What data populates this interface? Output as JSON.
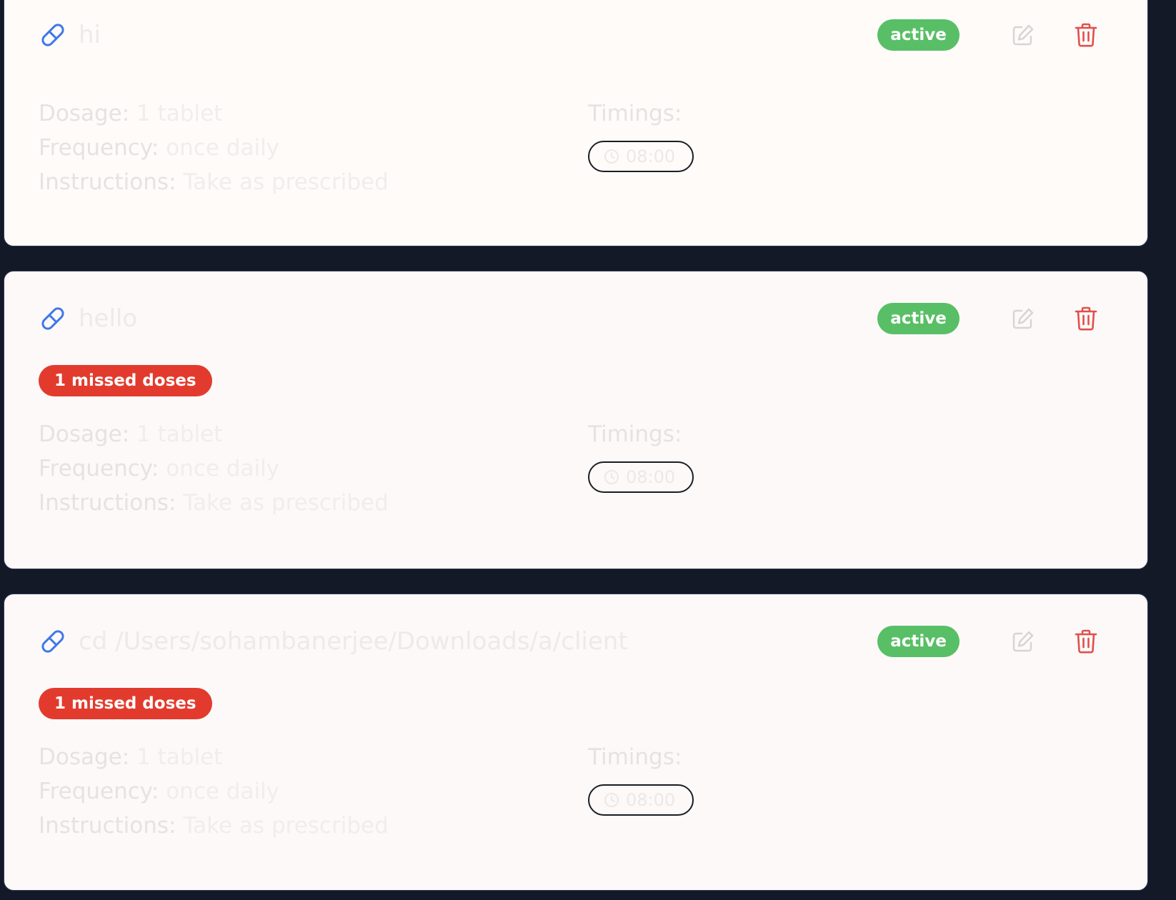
{
  "medications": [
    {
      "name": "hi",
      "status": "active",
      "missed": "",
      "dosage_label": "Dosage:",
      "dosage": "1 tablet",
      "frequency_label": "Frequency:",
      "frequency": "once daily",
      "instructions_label": "Instructions:",
      "instructions": "Take as prescribed",
      "timings_label": "Timings:",
      "time": "08:00"
    },
    {
      "name": "hello",
      "status": "active",
      "missed": "1 missed doses",
      "dosage_label": "Dosage:",
      "dosage": "1 tablet",
      "frequency_label": "Frequency:",
      "frequency": "once daily",
      "instructions_label": "Instructions:",
      "instructions": "Take as prescribed",
      "timings_label": "Timings:",
      "time": "08:00"
    },
    {
      "name": "cd /Users/sohambanerjee/Downloads/a/client",
      "status": "active",
      "missed": "1 missed doses",
      "dosage_label": "Dosage:",
      "dosage": "1 tablet",
      "frequency_label": "Frequency:",
      "frequency": "once daily",
      "instructions_label": "Instructions:",
      "instructions": "Take as prescribed",
      "timings_label": "Timings:",
      "time": "08:00"
    }
  ],
  "colors": {
    "page_background": "#131927",
    "card_background": "#fdf9f9",
    "status_active": "#58bf66",
    "missed_badge": "#e23b2e",
    "pill_icon": "#3f78e8",
    "delete_icon": "#e0504a",
    "edit_icon": "#d8d4d4"
  },
  "icons": {
    "medication": "pill-icon",
    "edit": "edit-icon",
    "delete": "trash-icon",
    "time": "clock-icon"
  }
}
